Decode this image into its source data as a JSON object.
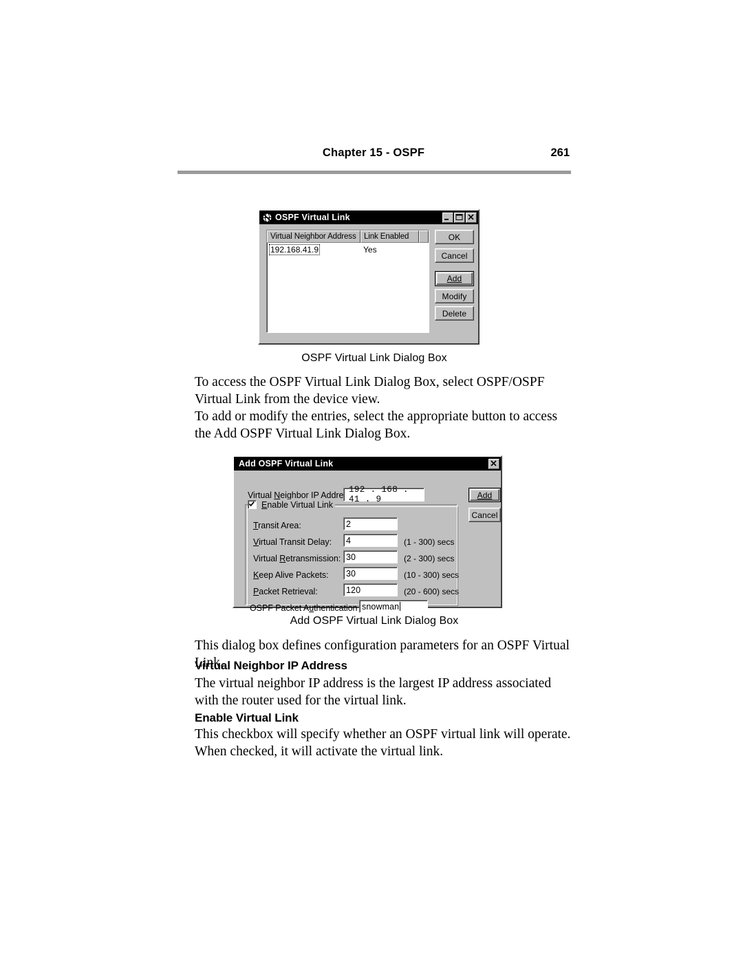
{
  "page": {
    "chapter_title": "Chapter 15 - OSPF",
    "page_number": "261"
  },
  "figure1": {
    "caption": "OSPF Virtual Link Dialog Box",
    "dialog": {
      "title": "OSPF Virtual Link",
      "icon": "globe-network-icon",
      "titlebar_buttons": [
        "minimize-button",
        "maximize-button",
        "close-button"
      ],
      "list": {
        "columns": [
          "Virtual Neighbor Address",
          "Link Enabled",
          ""
        ],
        "rows": [
          {
            "address": "192.168.41.9",
            "enabled": "Yes"
          }
        ]
      },
      "buttons": [
        {
          "label": "OK",
          "accel": "",
          "default": false
        },
        {
          "label": "Cancel",
          "accel": "",
          "default": false
        },
        {
          "label": "Add",
          "accel": "A",
          "default": true
        },
        {
          "label": "Modify",
          "accel": "M",
          "default": false
        },
        {
          "label": "Delete",
          "accel": "D",
          "default": false
        }
      ]
    }
  },
  "figure2": {
    "caption": "Add OSPF Virtual Link Dialog Box",
    "dialog": {
      "title": "Add OSPF Virtual Link",
      "titlebar_buttons": [
        "close-button"
      ],
      "ip_label": "Virtual Neighbor IP Address:",
      "ip_label_accel": "N",
      "ip_value": "192 . 168 .  41  .   9",
      "group_checkbox_label": "Enable Virtual Link",
      "group_checkbox_accel": "E",
      "group_checkbox_checked": true,
      "fields": [
        {
          "label": "Transit Area:",
          "accel": "T",
          "value": "2",
          "hint": ""
        },
        {
          "label": "Virtual Transit Delay:",
          "accel": "V",
          "value": "4",
          "hint": "(1 - 300) secs"
        },
        {
          "label": "Virtual Retransmission:",
          "accel": "R",
          "value": "30",
          "hint": "(2 - 300) secs"
        },
        {
          "label": "Keep Alive Packets:",
          "accel": "K",
          "value": "30",
          "hint": "(10 - 300) secs"
        },
        {
          "label": "Packet Retrieval:",
          "accel": "P",
          "value": "120",
          "hint": "(20 - 600) secs"
        }
      ],
      "auth_label": "OSPF Packet Authentication Key:",
      "auth_accel": "u",
      "auth_value": "snowman",
      "buttons": [
        {
          "label": "Add",
          "accel": "A",
          "default": true
        },
        {
          "label": "Cancel",
          "accel": "",
          "default": false
        }
      ]
    }
  },
  "body": {
    "para1": "To access the OSPF Virtual Link Dialog Box, select OSPF/OSPF Virtual Link from the device view.",
    "para2": "To add or modify the entries, select the appropriate button to access the Add OSPF Virtual Link Dialog Box.",
    "para3": "This dialog box defines configuration parameters for an OSPF Virtual Link.",
    "head1": "Virtual Neighbor IP Address",
    "para4": "The virtual neighbor IP address is the largest IP address associated with the router used for the virtual link.",
    "head2": "Enable Virtual Link",
    "para5": "This checkbox will specify whether an OSPF virtual link will operate. When checked, it will activate the virtual link."
  },
  "colors": {
    "page_background": "#ffffff",
    "rule": "#9a9a9a",
    "dialog_face": "#c0c0c0",
    "titlebar": "#000000",
    "text": "#000000"
  }
}
